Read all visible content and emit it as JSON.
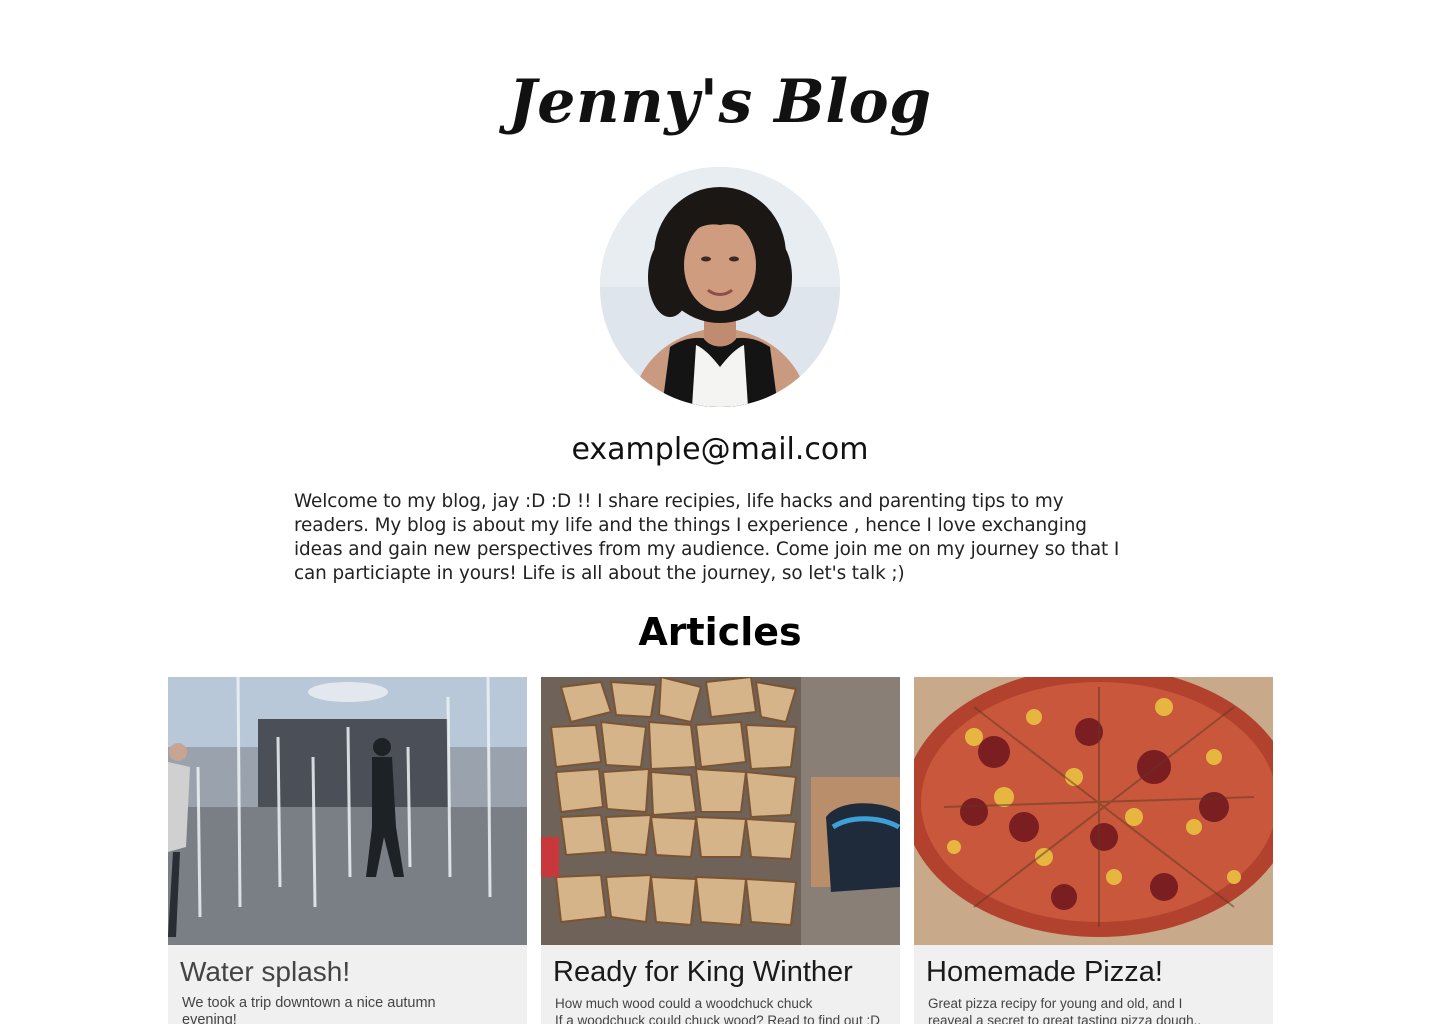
{
  "header": {
    "title": "Jenny's Blog"
  },
  "profile": {
    "avatar_icon": "portrait-photo",
    "email": "example@mail.com"
  },
  "intro": {
    "text": "Welcome to my blog, jay :D :D !! I share recipies, life hacks and parenting tips to my readers. My blog is about my life and the things I experience , hence I love exchanging ideas and gain new perspectives from my audience. Come join me on my journey so that I can particiapte in yours! Life is all about the journey, so let's talk ;)"
  },
  "articles": {
    "heading": "Articles",
    "items": [
      {
        "title": "Water splash!",
        "description_lines": [
          "We took a trip downtown a nice autumn",
          "evening!"
        ],
        "image": "fountain-photo"
      },
      {
        "title": "Ready for King Winther",
        "description_lines": [
          "How much wood could a woodchuck chuck",
          "If a woodchuck could chuck wood? Read to find out :D"
        ],
        "image": "firewood-photo"
      },
      {
        "title": "Homemade Pizza!",
        "description_lines": [
          "Great pizza recipy for young and old, and I",
          "reaveal a secret to great tasting pizza dough.."
        ],
        "image": "pizza-photo"
      }
    ]
  },
  "colors": {
    "background": "#ffffff",
    "card_background": "#f0f0f0",
    "text": "#111111"
  }
}
